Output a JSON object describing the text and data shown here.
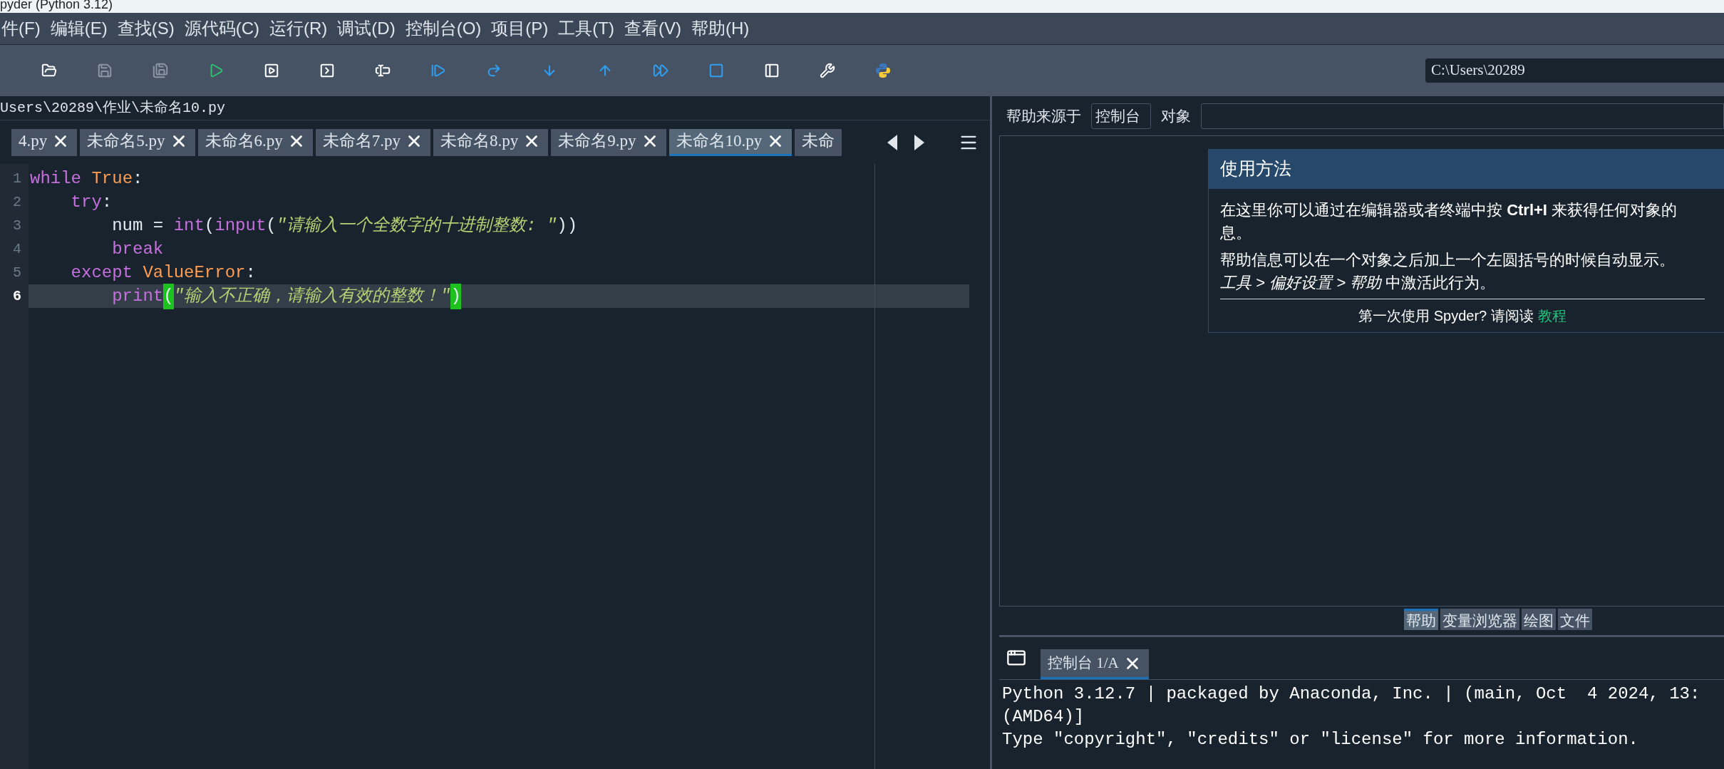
{
  "window": {
    "title": "pyder (Python 3.12)"
  },
  "menu": [
    {
      "label": "件(F)"
    },
    {
      "label": "编辑(E)"
    },
    {
      "label": "查找(S)"
    },
    {
      "label": "源代码(C)"
    },
    {
      "label": "运行(R)"
    },
    {
      "label": "调试(D)"
    },
    {
      "label": "控制台(O)"
    },
    {
      "label": "项目(P)"
    },
    {
      "label": "工具(T)"
    },
    {
      "label": "查看(V)"
    },
    {
      "label": "帮助(H)"
    }
  ],
  "toolbar": {
    "working_directory": "C:\\Users\\20289"
  },
  "editor": {
    "path": "Users\\20289\\作业\\未命名10.py",
    "tabs": [
      {
        "label": "4.py",
        "selected": false,
        "closable": true
      },
      {
        "label": "未命名5.py",
        "selected": false,
        "closable": true
      },
      {
        "label": "未命名6.py",
        "selected": false,
        "closable": true
      },
      {
        "label": "未命名7.py",
        "selected": false,
        "closable": true
      },
      {
        "label": "未命名8.py",
        "selected": false,
        "closable": true
      },
      {
        "label": "未命名9.py",
        "selected": false,
        "closable": true
      },
      {
        "label": "未命名10.py",
        "selected": true,
        "closable": true
      },
      {
        "label": "未命",
        "selected": false,
        "closable": false
      }
    ],
    "lines": [
      {
        "number": "1",
        "current": false,
        "tokens": [
          {
            "text": "while ",
            "kind": "keyword"
          },
          {
            "text": "True",
            "kind": "constant"
          },
          {
            "text": ":",
            "kind": "plain"
          }
        ]
      },
      {
        "number": "2",
        "current": false,
        "tokens": [
          {
            "text": "    try",
            "kind": "keyword"
          },
          {
            "text": ":",
            "kind": "plain"
          }
        ]
      },
      {
        "number": "3",
        "current": false,
        "tokens": [
          {
            "text": "        num = ",
            "kind": "plain"
          },
          {
            "text": "int",
            "kind": "keyword"
          },
          {
            "text": "(",
            "kind": "plain"
          },
          {
            "text": "input",
            "kind": "keyword"
          },
          {
            "text": "(",
            "kind": "plain"
          },
          {
            "text": "\"请输入一个全数字的十进制整数: \"",
            "kind": "string"
          },
          {
            "text": "))",
            "kind": "plain"
          }
        ]
      },
      {
        "number": "4",
        "current": false,
        "tokens": [
          {
            "text": "        break",
            "kind": "keyword"
          }
        ]
      },
      {
        "number": "5",
        "current": false,
        "tokens": [
          {
            "text": "    except ",
            "kind": "keyword"
          },
          {
            "text": "ValueError",
            "kind": "constant"
          },
          {
            "text": ":",
            "kind": "plain"
          }
        ]
      },
      {
        "number": "6",
        "current": true,
        "tokens": [
          {
            "text": "        print",
            "kind": "keyword"
          },
          {
            "text": "(",
            "kind": "match"
          },
          {
            "text": "\"输入不正确，请输入有效的整数！\"",
            "kind": "string"
          },
          {
            "text": ")",
            "kind": "match"
          }
        ]
      }
    ]
  },
  "help": {
    "source_label": "帮助来源于",
    "source": "控制台",
    "object_label": "对象",
    "card": {
      "title": "使用方法",
      "paragraphs": [
        [
          "在这里你可以通过在编辑器或者终端中按 **Ctrl+I** 来获得任何对象的",
          "息。"
        ],
        [
          "帮助信息可以在一个对象之后加上一个左圆括号的时候自动显示。",
          "*工具 > 偏好设置 > 帮助* 中激活此行为。"
        ]
      ],
      "footer": "第一次使用 Spyder? 请阅读",
      "link": "教程"
    }
  },
  "pane_tabs": [
    {
      "label": "帮助",
      "selected": true
    },
    {
      "label": "变量浏览器",
      "selected": false
    },
    {
      "label": "绘图",
      "selected": false
    },
    {
      "label": "文件",
      "selected": false
    }
  ],
  "console": {
    "tab": "控制台 1/A",
    "lines": [
      "Python 3.12.7 | packaged by Anaconda, Inc. | (main, Oct  4 2024, 13:",
      "(AMD64)]",
      "Type \"copyright\", \"credits\" or \"license\" for more information."
    ]
  }
}
